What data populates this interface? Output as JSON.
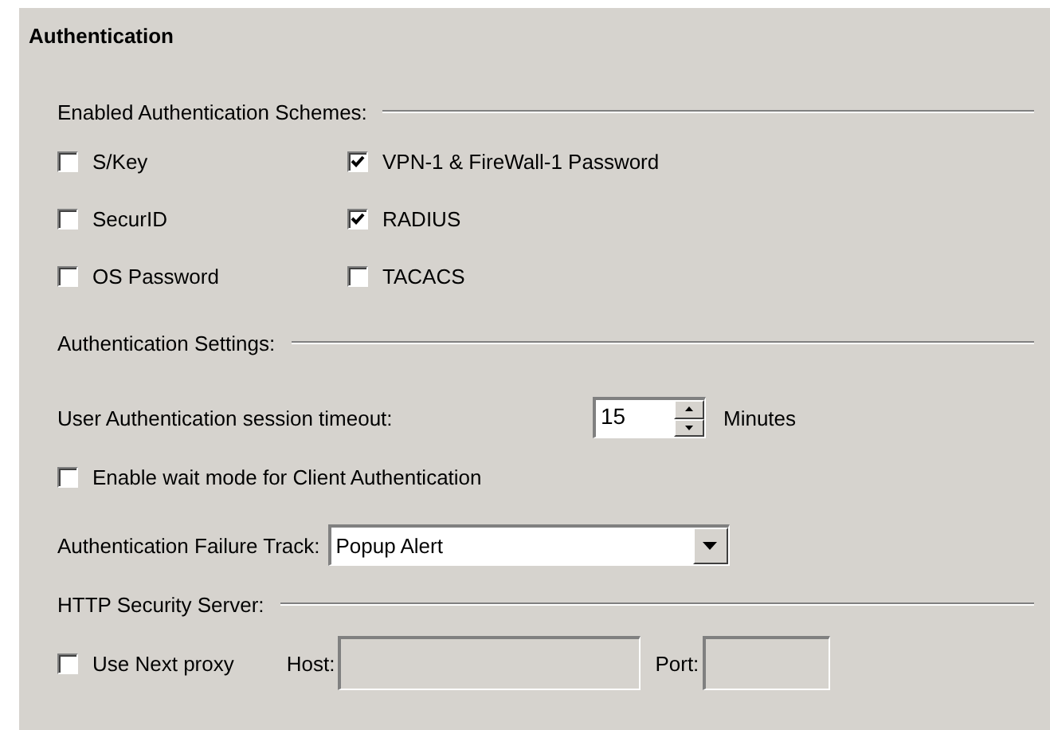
{
  "title": "Authentication",
  "schemes": {
    "heading": "Enabled Authentication Schemes:",
    "items": [
      {
        "label": "S/Key",
        "checked": false
      },
      {
        "label": "VPN-1 & FireWall-1 Password",
        "checked": true
      },
      {
        "label": "SecurID",
        "checked": false
      },
      {
        "label": "RADIUS",
        "checked": true
      },
      {
        "label": "OS Password",
        "checked": false
      },
      {
        "label": "TACACS",
        "checked": false
      }
    ]
  },
  "settings": {
    "heading": "Authentication Settings:",
    "timeout_label": "User Authentication session timeout:",
    "timeout_value": "15",
    "timeout_unit": "Minutes",
    "wait_mode": {
      "label": "Enable wait mode for Client Authentication",
      "checked": false
    },
    "failure_track_label": "Authentication Failure Track:",
    "failure_track_value": "Popup Alert"
  },
  "http": {
    "heading": "HTTP Security Server:",
    "use_next_proxy": {
      "label": "Use Next proxy",
      "checked": false
    },
    "host_label": "Host:",
    "host_disabled": true,
    "port_label": "Port:",
    "port_disabled": true
  }
}
